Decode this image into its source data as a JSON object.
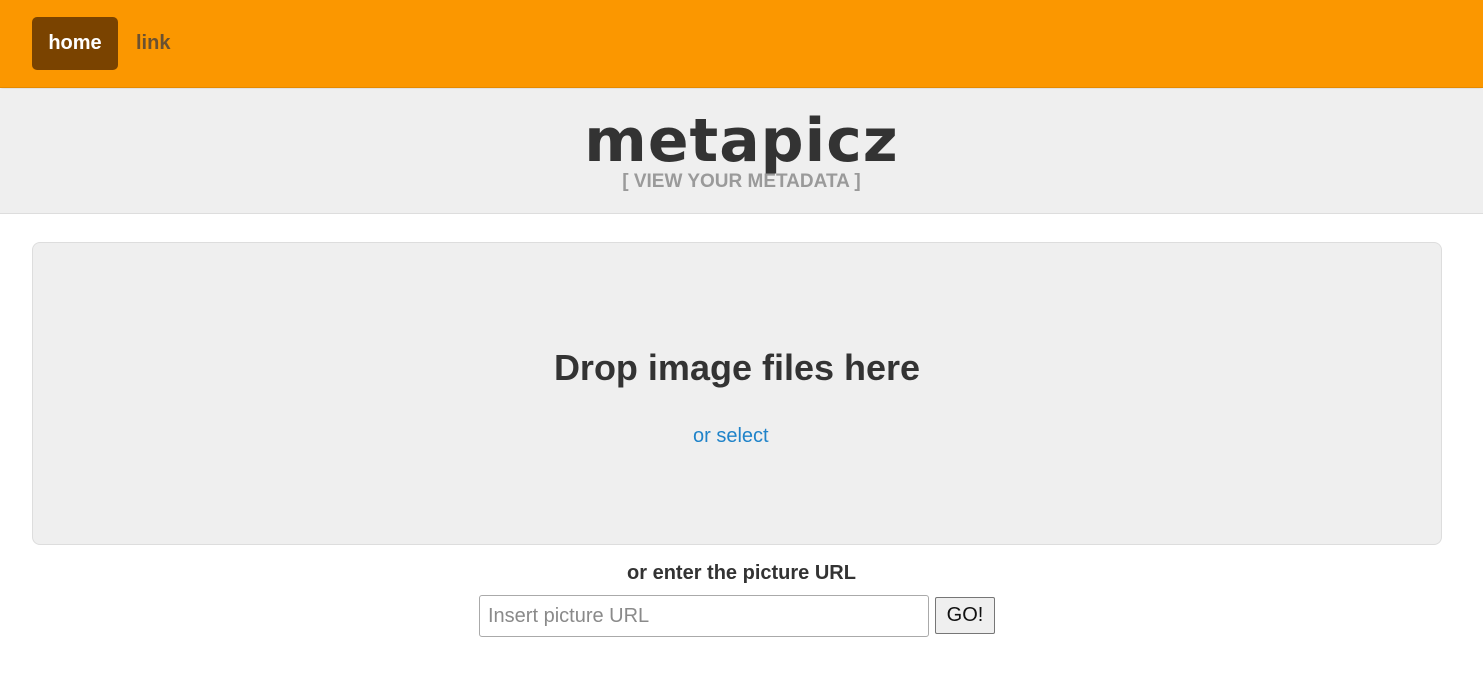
{
  "nav": {
    "items": [
      {
        "label": "home",
        "active": true
      },
      {
        "label": "link",
        "active": false
      }
    ]
  },
  "hero": {
    "brand": "metapicz",
    "tagline": "[ VIEW YOUR METADATA ]"
  },
  "dropzone": {
    "title": "Drop image files here",
    "select_label": "or select"
  },
  "url_form": {
    "label": "or enter the picture URL",
    "placeholder": "Insert picture URL",
    "value": "",
    "button_label": "GO!"
  },
  "colors": {
    "navbar": "#fb9700",
    "active_nav": "#7a4300",
    "hero_bg": "#efefef",
    "link": "#1f83c9"
  }
}
